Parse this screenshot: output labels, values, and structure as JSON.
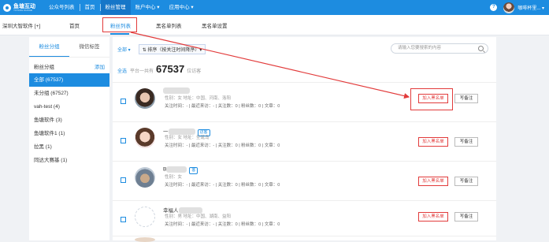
{
  "topbar": {
    "logo_title": "鱼塘互动",
    "logo_subtitle": "YUTANG NUDGE",
    "nav": [
      {
        "label": "公众号列表"
      },
      {
        "label": "首页"
      },
      {
        "label": "粉丝管理"
      },
      {
        "label": "账户中心 ▾"
      },
      {
        "label": "应用中心 ▾"
      }
    ],
    "help": "?",
    "username": "咖啡杯里... ▾"
  },
  "subbar": {
    "company": "深圳大智软件 [+]",
    "tabs": [
      {
        "label": "首页"
      },
      {
        "label": "粉丝列表"
      },
      {
        "label": "黑名单列表"
      },
      {
        "label": "黑名单设置"
      }
    ]
  },
  "sidebar": {
    "tabs": [
      {
        "label": "粉丝分组"
      },
      {
        "label": "微信标签"
      }
    ],
    "heading": "粉丝分组",
    "add_label": "添加",
    "groups": [
      {
        "label": "全部 (67537)"
      },
      {
        "label": "未分组 (67527)"
      },
      {
        "label": "vah-test (4)"
      },
      {
        "label": "鱼塘软件 (3)"
      },
      {
        "label": "鱼塘软件1 (1)"
      },
      {
        "label": "拉黑 (1)"
      },
      {
        "label": "同达大赛基 (1)"
      }
    ]
  },
  "main": {
    "filter_all": "全部 ▾",
    "sort_label": "⇅ 排序（按关注时间降序）▾",
    "search_placeholder": "请输入您要搜索的内容",
    "select_all": "全选",
    "count_prefix": "平台一共有",
    "count_value": "67537",
    "count_suffix": "位访客",
    "fans": [
      {
        "name": "",
        "tag": "",
        "info": "性别：女  地址：中国、河南、洛阳",
        "stats": "关注时间：-  |  最近来访：-  |  关注数：0  |  粉丝数：0  |  文章：0"
      },
      {
        "name": "一",
        "tag": "访客",
        "info": "性别：女  地址：圣诞岛",
        "stats": "关注时间：-  |  最近来访：-  |  关注数：0  |  粉丝数：0  |  文章：0"
      },
      {
        "name": "B",
        "tag": "客",
        "info": "性别：女",
        "stats": "关注时间：-  |  最近来访：-  |  关注数：0  |  粉丝数：0  |  文章：0"
      },
      {
        "name": "幸福人",
        "tag": "",
        "info": "性别：男  地址：中国、湖南、益阳",
        "stats": "关注时间：-  |  最近来访：-  |  关注数：0  |  粉丝数：0  |  文章：0"
      }
    ],
    "btn_blacklist": "加入黑名单",
    "btn_remark": "写备注"
  },
  "colors": {
    "accent": "#1d8ce0",
    "highlight": "#e23b3b"
  }
}
